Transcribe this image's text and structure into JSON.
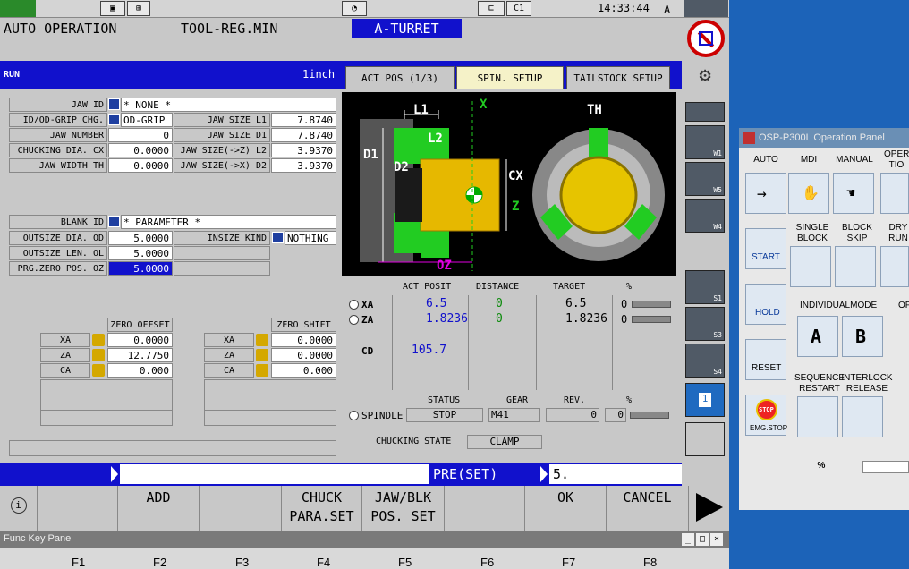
{
  "top_bar": {
    "clock": "14:33:44",
    "mode_letter": "A",
    "c_label": "C1"
  },
  "header": {
    "mode": "AUTO OPERATION",
    "program": "TOOL-REG.MIN",
    "turret": "A-TURRET"
  },
  "run_bar": {
    "run": "RUN",
    "unit": "1inch"
  },
  "tabs": [
    "ACT POS (1/3)",
    "SPIN. SETUP",
    "TAILSTOCK SETUP"
  ],
  "jaw": {
    "jaw_id_label": "JAW ID",
    "jaw_id_value": "* NONE *",
    "grip_label": "ID/OD-GRIP CHG.",
    "grip_value": "OD-GRIP",
    "number_label": "JAW NUMBER",
    "number_value": "0",
    "chucking_label": "CHUCKING DIA. CX",
    "chucking_value": "0.0000",
    "width_label": "JAW WIDTH TH",
    "width_value": "0.0000",
    "size_l1_label": "JAW SIZE L1",
    "size_l1_value": "7.8740",
    "size_d1_label": "JAW SIZE D1",
    "size_d1_value": "7.8740",
    "size_l2_label": "JAW SIZE(->Z) L2",
    "size_l2_value": "3.9370",
    "size_d2_label": "JAW SIZE(->X) D2",
    "size_d2_value": "3.9370"
  },
  "blank": {
    "id_label": "BLANK ID",
    "id_value": "* PARAMETER *",
    "od_label": "OUTSIZE DIA. OD",
    "od_value": "5.0000",
    "ol_label": "OUTSIZE LEN. OL",
    "ol_value": "5.0000",
    "oz_label": "PRG.ZERO POS. OZ",
    "oz_value": "5.0000",
    "inside_label": "INSIZE KIND",
    "inside_value": "NOTHING"
  },
  "zero_offset": {
    "header": "ZERO OFFSET",
    "rows": [
      {
        "axis": "XA",
        "value": "0.0000"
      },
      {
        "axis": "ZA",
        "value": "12.7750"
      },
      {
        "axis": "CA",
        "value": "0.000"
      }
    ]
  },
  "zero_shift": {
    "header": "ZERO SHIFT",
    "rows": [
      {
        "axis": "XA",
        "value": "0.0000"
      },
      {
        "axis": "ZA",
        "value": "0.0000"
      },
      {
        "axis": "CA",
        "value": "0.000"
      }
    ]
  },
  "diagram": {
    "l1": "L1",
    "l2": "L2",
    "d1": "D1",
    "d2": "D2",
    "cx": "CX",
    "x": "X",
    "z": "Z",
    "th": "TH",
    "oz": "OZ"
  },
  "positions": {
    "headers": [
      "ACT POSIT",
      "DISTANCE",
      "TARGET",
      "%"
    ],
    "rows": [
      {
        "axis": "XA",
        "act": "6.5",
        "dist": "0",
        "target": "6.5",
        "pct": "0"
      },
      {
        "axis": "ZA",
        "act": "1.8236",
        "dist": "0",
        "target": "1.8236",
        "pct": "0"
      }
    ],
    "cd_label": "CD",
    "cd_value": "105.7"
  },
  "spindle": {
    "label": "SPINDLE",
    "headers": [
      "STATUS",
      "GEAR",
      "REV.",
      "%"
    ],
    "status": "STOP",
    "gear": "M41",
    "rev": "0",
    "pct": "0",
    "chuck_label": "CHUCKING STATE",
    "chuck_value": "CLAMP"
  },
  "status_bar": {
    "preset": "PRE(SET)",
    "input": "5."
  },
  "softkeys": {
    "add": "ADD",
    "chuck1": "CHUCK",
    "chuck2": "PARA.SET",
    "jaw1": "JAW/BLK",
    "jaw2": "POS. SET",
    "ok": "OK",
    "cancel": "CANCEL"
  },
  "func_panel": {
    "title": "Func Key Panel",
    "keys": [
      "F1",
      "F2",
      "F3",
      "F4",
      "F5",
      "F6",
      "F7",
      "F8"
    ]
  },
  "sidebar": {
    "w1": "W1",
    "w5": "W5",
    "w4": "W4",
    "s1": "S1",
    "s3": "S3",
    "s4": "S4",
    "page": "1"
  },
  "op_panel": {
    "title": "OSP-P300L Operation Panel",
    "modes": [
      "AUTO",
      "MDI",
      "MANUAL",
      "OPER TIO"
    ],
    "single_block": "SINGLE BLOCK",
    "block_skip": "BLOCK SKIP",
    "dry_run": "DRY RUN",
    "start": "START",
    "hold": "HOLD",
    "reset": "RESET",
    "stop": "STOP",
    "emg": "EMG.STOP",
    "individual": "INDIVIDUALMODE",
    "a": "A",
    "b": "B",
    "op": "OF",
    "sequence": "SEQUENCE RESTART",
    "interlock": "INTERLOCK RELEASE",
    "feed": "%"
  }
}
